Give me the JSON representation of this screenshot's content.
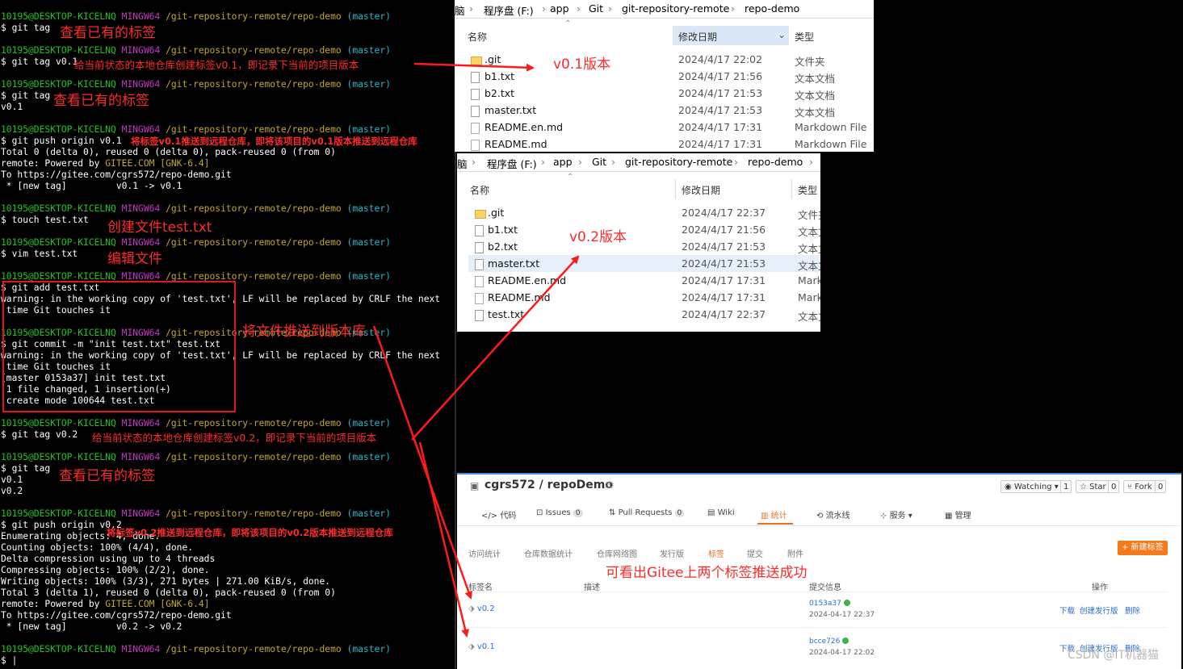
{
  "terminal": {
    "prompt_user": "10195@DESKTOP-KICELNQ",
    "prompt_env": "MINGW64",
    "prompt_path": "/git-repository-remote/repo-demo",
    "prompt_branch": "(master)",
    "cmd_tag1": "$ git tag",
    "cmd_tagv01": "$ git tag v0.1",
    "cmd_tag2": "$ git tag",
    "out_v01": "v0.1",
    "cmd_push1": "$ git push origin v0.1",
    "push1_total": "Total 0 (delta 0), reused 0 (delta 0), pack-reused 0 (from 0)",
    "remote_prefix": "remote: Powered by ",
    "gitee_com": "GITEE.COM",
    "gnk": "[GNK-6.4]",
    "to_url": "To https://gitee.com/cgrs572/repo-demo.git",
    "newtag1": " * [new tag]         v0.1 -> v0.1",
    "cmd_touch": "$ touch test.txt",
    "cmd_vim": "$ vim test.txt",
    "cmd_add": "$ git add test.txt",
    "warn1": "warning: in the working copy of 'test.txt', LF will be replaced by CRLF the next",
    "warn2": " time Git touches it",
    "cmd_commit": "$ git commit -m \"init test.txt\" test.txt",
    "commit_out": "[master 0153a37] init test.txt",
    "changed": " 1 file changed, 1 insertion(+)",
    "create_mode": " create mode 100644 test.txt",
    "cmd_tagv02": "$ git tag v0.2",
    "cmd_tag3": "$ git tag",
    "out_v02": "v0.2",
    "cmd_push2": "$ git push origin v0.2",
    "enum": "Enumerating objects: 4, done.",
    "counting": "Counting objects: 100% (4/4), done.",
    "delta": "Delta compression using up to 4 threads",
    "compressing": "Compressing objects: 100% (2/2), done.",
    "writing": "Writing objects: 100% (3/3), 271 bytes | 271.00 KiB/s, done.",
    "push2_total": "Total 3 (delta 1), reused 0 (delta 0), pack-reused 0 (from 0)",
    "newtag2": " * [new tag]         v0.2 -> v0.2",
    "last_prompt": "$ |"
  },
  "annotations": {
    "view_tags": "查看已有的标签",
    "create_v01": "给当前状态的本地仓库创建标签v0.1，即记录下当前的项目版本",
    "push_v01": "将标签v0.1推送到远程仓库，即将该项目的v0.1版本推送到远程仓库",
    "create_file": "创建文件test.txt",
    "edit_file": "编辑文件",
    "push_file": "将文件推送到版本库",
    "create_v02": "给当前状态的本地仓库创建标签v0.2，即记录下当前的项目版本",
    "push_v02": "将标签v0.2推送到远程仓库，即将该项目的v0.2版本推送到远程仓库",
    "v01_version": "v0.1版本",
    "v02_version": "v0.2版本",
    "gitee_success": "可看出Gitee上两个标签推送成功"
  },
  "explorer1": {
    "breadcrumb": [
      "脑",
      "程序盘 (F:)",
      "app",
      "Git",
      "git-repository-remote",
      "repo-demo"
    ],
    "col_name": "名称",
    "col_date": "修改日期",
    "col_type": "类型",
    "files": [
      {
        "name": ".git",
        "date": "2024/4/17 22:02",
        "type": "文件夹",
        "icon": "folder-icon"
      },
      {
        "name": "b1.txt",
        "date": "2024/4/17 21:56",
        "type": "文本文档",
        "icon": "text-file-icon"
      },
      {
        "name": "b2.txt",
        "date": "2024/4/17 21:53",
        "type": "文本文档",
        "icon": "text-file-icon"
      },
      {
        "name": "master.txt",
        "date": "2024/4/17 21:53",
        "type": "文本文档",
        "icon": "text-file-icon"
      },
      {
        "name": "README.en.md",
        "date": "2024/4/17 17:31",
        "type": "Markdown File",
        "icon": "md-file-icon"
      },
      {
        "name": "README.md",
        "date": "2024/4/17 17:31",
        "type": "Markdown File",
        "icon": "md-file-icon"
      }
    ]
  },
  "explorer2": {
    "breadcrumb": [
      "脑",
      "程序盘 (F:)",
      "app",
      "Git",
      "git-repository-remote",
      "repo-demo"
    ],
    "col_name": "名称",
    "col_date": "修改日期",
    "col_type": "类型",
    "files": [
      {
        "name": ".git",
        "date": "2024/4/17 22:37",
        "type": "文件夹",
        "icon": "folder-icon"
      },
      {
        "name": "b1.txt",
        "date": "2024/4/17 21:56",
        "type": "文本文",
        "icon": "text-file-icon"
      },
      {
        "name": "b2.txt",
        "date": "2024/4/17 21:53",
        "type": "文本文",
        "icon": "text-file-icon"
      },
      {
        "name": "master.txt",
        "date": "2024/4/17 21:53",
        "type": "文本文",
        "icon": "text-file-icon"
      },
      {
        "name": "README.en.md",
        "date": "2024/4/17 17:31",
        "type": "Mark",
        "icon": "md-file-icon"
      },
      {
        "name": "README.md",
        "date": "2024/4/17 17:31",
        "type": "Mark",
        "icon": "md-file-icon"
      },
      {
        "name": "test.txt",
        "date": "2024/4/17 22:37",
        "type": "文本文",
        "icon": "text-file-icon"
      }
    ]
  },
  "gitee": {
    "repo_title": "cgrs572 / repoDemo",
    "watching": "Watching",
    "watching_count": "1",
    "star": "Star",
    "star_count": "0",
    "fork": "Fork",
    "fork_count": "0",
    "nav": [
      "代码",
      "Issues",
      "Pull Requests",
      "Wiki",
      "统计",
      "流水线",
      "服务",
      "管理"
    ],
    "issues_count": "0",
    "pr_count": "0",
    "subnav": [
      "访问统计",
      "仓库数据统计",
      "仓库网络图",
      "发行版",
      "标签",
      "提交",
      "附件"
    ],
    "new_tag_button": "+ 新建标签",
    "col_tag": "标签名",
    "col_desc": "描述",
    "col_commit": "提交信息",
    "col_ops": "操作",
    "tags": [
      {
        "name": "v0.2",
        "commit": "0153a37",
        "time": "2024-04-17 22:37"
      },
      {
        "name": "v0.1",
        "commit": "bcce726",
        "time": "2024-04-17 22:02"
      }
    ],
    "op_download": "下载",
    "op_release": "创建发行版",
    "op_delete": "删除"
  },
  "watermark": "CSDN @IT机器猫",
  "colors": {
    "annotation": "#ff2a2a",
    "prompt_green": "#21c321",
    "prompt_magenta": "#c337c3",
    "prompt_yellow": "#c3a826",
    "prompt_cyan": "#22b8c8",
    "gitee_link": "#2a6fd6"
  }
}
